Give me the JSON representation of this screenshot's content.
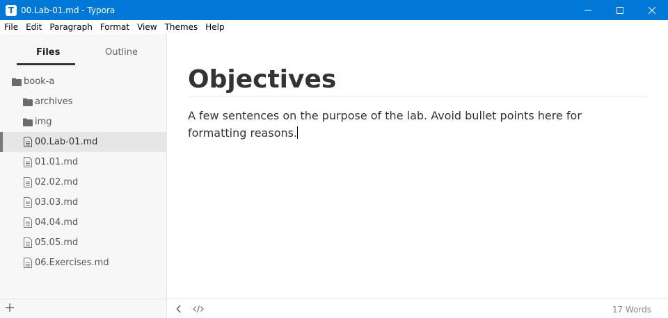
{
  "window": {
    "app_icon_letter": "T",
    "title": "00.Lab-01.md - Typora",
    "accent": "#0078d7"
  },
  "menu": [
    "File",
    "Edit",
    "Paragraph",
    "Format",
    "View",
    "Themes",
    "Help"
  ],
  "sidebar": {
    "tabs": {
      "files": "Files",
      "outline": "Outline"
    },
    "active_tab": "files",
    "tree": [
      {
        "label": "book-a",
        "icon": "folder-icon",
        "type": "folder"
      },
      {
        "label": "archives",
        "icon": "folder-icon",
        "type": "folder"
      },
      {
        "label": "img",
        "icon": "folder-icon",
        "type": "folder"
      },
      {
        "label": "00.Lab-01.md",
        "icon": "file-icon",
        "type": "file",
        "active": true
      },
      {
        "label": "01.01.md",
        "icon": "file-icon",
        "type": "file"
      },
      {
        "label": "02.02.md",
        "icon": "file-icon",
        "type": "file"
      },
      {
        "label": "03.03.md",
        "icon": "file-icon",
        "type": "file"
      },
      {
        "label": "04.04.md",
        "icon": "file-icon",
        "type": "file"
      },
      {
        "label": "05.05.md",
        "icon": "file-icon",
        "type": "file"
      },
      {
        "label": "06.Exercises.md",
        "icon": "file-icon",
        "type": "file"
      }
    ],
    "footer_add_icon": "plus-icon"
  },
  "editor": {
    "heading": "Objectives",
    "paragraph": "A few sentences on the purpose of the lab. Avoid bullet points here for formatting reasons."
  },
  "statusbar": {
    "toggle_sidebar_icon": "chevron-left-icon",
    "source_mode_icon": "code-icon",
    "word_count": "17 Words"
  }
}
